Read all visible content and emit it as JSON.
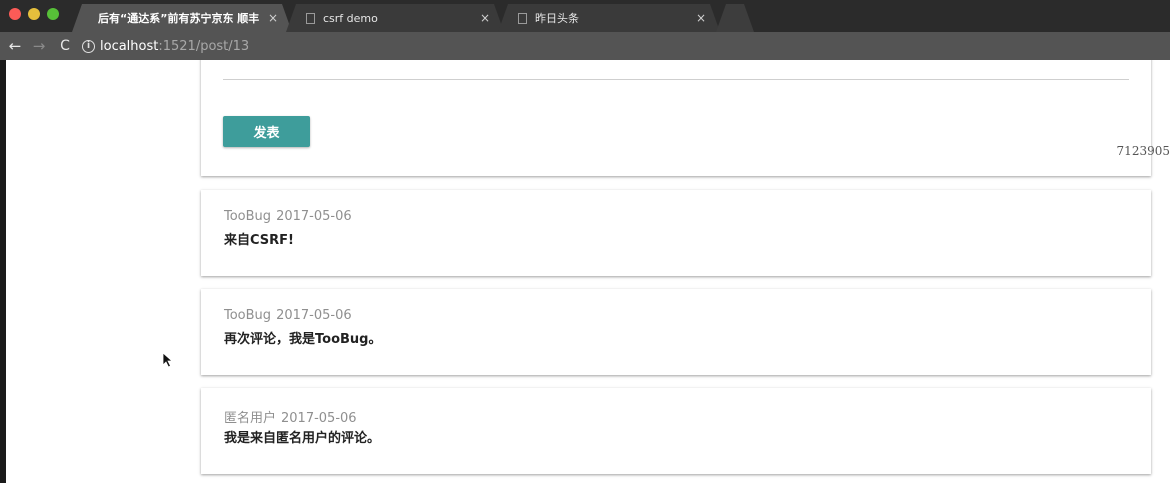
{
  "browser": {
    "tabs": [
      {
        "title": "后有“通达系”前有苏宁京东 顺丰",
        "close": "×",
        "active": true
      },
      {
        "title": "csrf demo",
        "close": "×",
        "active": false
      },
      {
        "title": "昨日头条",
        "close": "×",
        "active": false
      }
    ],
    "url": {
      "host": "localhost",
      "path": ":1521/post/13"
    },
    "nav": {
      "back": "←",
      "forward": "→",
      "reload": "C",
      "info": "i"
    }
  },
  "page": {
    "publish_button": "发表",
    "watermark": "7123905",
    "comments": [
      {
        "author": "TooBug",
        "date": "2017-05-06",
        "body": "来自CSRF!"
      },
      {
        "author": "TooBug",
        "date": "2017-05-06",
        "body": "再次评论，我是TooBug。"
      },
      {
        "author": "匿名用户",
        "date": "2017-05-06",
        "body": "我是来自匿名用户的评论。"
      }
    ]
  },
  "colors": {
    "accent": "#3e9d9b",
    "tab_bar": "#2b2b2b",
    "toolbar": "#545454"
  }
}
